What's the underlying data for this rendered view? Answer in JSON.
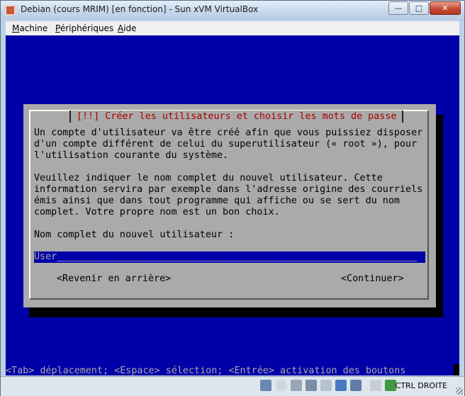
{
  "window": {
    "title": "Debian (cours MRIM) [en fonction] - Sun xVM VirtualBox",
    "buttons": {
      "minimize": "—",
      "maximize": "□",
      "close": "✕"
    }
  },
  "menubar": {
    "items": [
      {
        "accel": "M",
        "rest": "achine"
      },
      {
        "accel": "P",
        "rest": "ériphériques"
      },
      {
        "accel": "A",
        "rest": "ide"
      }
    ]
  },
  "dialog": {
    "title": "[!!] Créer les utilisateurs et choisir les mots de passe",
    "paragraph1": "Un compte d'utilisateur va être créé afin que vous puissiez disposer\nd'un compte différent de celui du superutilisateur (« root »), pour\nl'utilisation courante du système.",
    "paragraph2": "Veuillez indiquer le nom complet du nouvel utilisateur. Cette\ninformation servira par exemple dans l'adresse origine des courriels\némis ainsi que dans tout programme qui affiche ou se sert du nom\ncomplet. Votre propre nom est un bon choix.",
    "field_label": "Nom complet du nouvel utilisateur :",
    "field_value": "User",
    "field_fill": "_______________________________________________________________",
    "back_button": "<Revenir en arrière>",
    "continue_button": "<Continuer>"
  },
  "status_line": "<Tab> déplacement; <Espace> sélection; <Entrée> activation des boutons",
  "statusbar": {
    "host_key": "CTRL DROITE",
    "icons": [
      "hard-disk-icon",
      "cd-icon",
      "floppy-icon",
      "network-icon",
      "usb-icon",
      "shared-folder-icon",
      "monitor-icon",
      "mouse-icon",
      "host-key-icon"
    ]
  }
}
